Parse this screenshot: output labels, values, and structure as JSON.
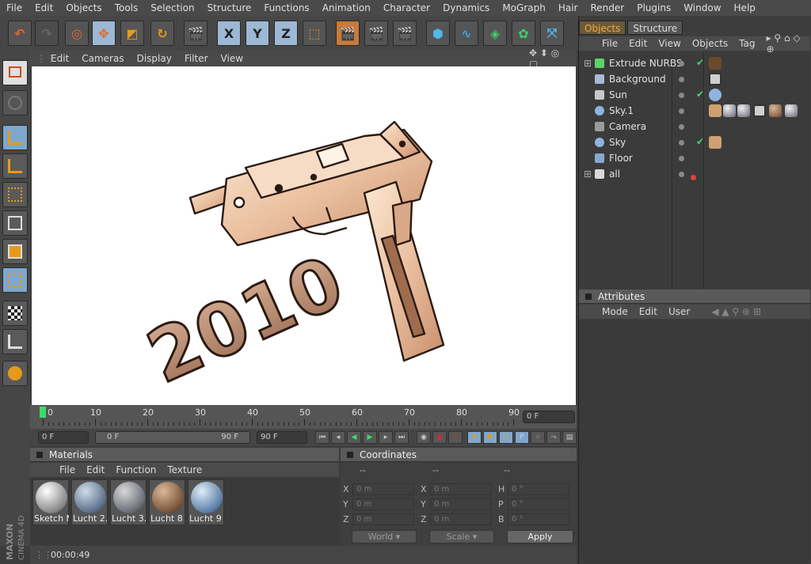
{
  "menubar": [
    "File",
    "Edit",
    "Objects",
    "Tools",
    "Selection",
    "Structure",
    "Functions",
    "Animation",
    "Character",
    "Dynamics",
    "MoGraph",
    "Hair",
    "Render",
    "Plugins",
    "Window",
    "Help"
  ],
  "toolbar": {
    "axis_x": "X",
    "axis_y": "Y",
    "axis_z": "Z"
  },
  "viewport_menu": [
    "Edit",
    "Cameras",
    "Display",
    "Filter",
    "View"
  ],
  "scene": {
    "text3d": "2010"
  },
  "timeline": {
    "labels": [
      "0",
      "10",
      "20",
      "30",
      "40",
      "50",
      "60",
      "70",
      "80",
      "90"
    ],
    "current_frame": "0 F",
    "start_field": "0 F",
    "range_start": "0 F",
    "range_end": "90 F",
    "end_field": "90 F"
  },
  "materials": {
    "title": "Materials",
    "menu": [
      "File",
      "Edit",
      "Function",
      "Texture"
    ],
    "items": [
      {
        "label": "Sketch M",
        "color": "#cfcfcf"
      },
      {
        "label": "Lucht 2.",
        "color": "#7e93ad"
      },
      {
        "label": "Lucht 3.",
        "color": "#8a8f98"
      },
      {
        "label": "Lucht 8",
        "color": "#8a6a4e"
      },
      {
        "label": "Lucht 9",
        "color": "#6f8fb8"
      }
    ]
  },
  "coordinates": {
    "title": "Coordinates",
    "col1_header": "--",
    "col2_header": "--",
    "col3_header": "--",
    "rows": [
      {
        "a": "X",
        "av": "0 m",
        "b": "X",
        "bv": "0 m",
        "c": "H",
        "cv": "0 °"
      },
      {
        "a": "Y",
        "av": "0 m",
        "b": "Y",
        "bv": "0 m",
        "c": "P",
        "cv": "0 °"
      },
      {
        "a": "Z",
        "av": "0 m",
        "b": "Z",
        "bv": "0 m",
        "c": "B",
        "cv": "0 °"
      }
    ],
    "world": "World",
    "scale": "Scale",
    "apply": "Apply"
  },
  "objects_panel": {
    "tab_objects": "Objects",
    "tab_structure": "Structure",
    "menu": [
      "File",
      "Edit",
      "View",
      "Objects",
      "Tag"
    ],
    "rows": [
      {
        "name": "Extrude NURBS",
        "icon_color": "#5fd06a",
        "check": "✔"
      },
      {
        "name": "Background",
        "icon_color": "#a9b9d6",
        "check": ""
      },
      {
        "name": "Sun",
        "icon_color": "#c8c8c8",
        "check": "✔"
      },
      {
        "name": "Sky.1",
        "icon_color": "#8fb4e0",
        "check": ""
      },
      {
        "name": "Camera",
        "icon_color": "#9a9a9a",
        "check": ""
      },
      {
        "name": "Sky",
        "icon_color": "#8fb4e0",
        "check": "✔"
      },
      {
        "name": "Floor",
        "icon_color": "#8aa6cf",
        "check": ""
      },
      {
        "name": "all",
        "icon_color": "#d8d8d8",
        "check": ""
      }
    ]
  },
  "attributes": {
    "title": "Attributes",
    "menu": [
      "Mode",
      "Edit",
      "User"
    ]
  },
  "status": {
    "time": "00:00:49"
  },
  "brand": {
    "line1": "MAXON",
    "line2": "CINEMA 4D"
  }
}
